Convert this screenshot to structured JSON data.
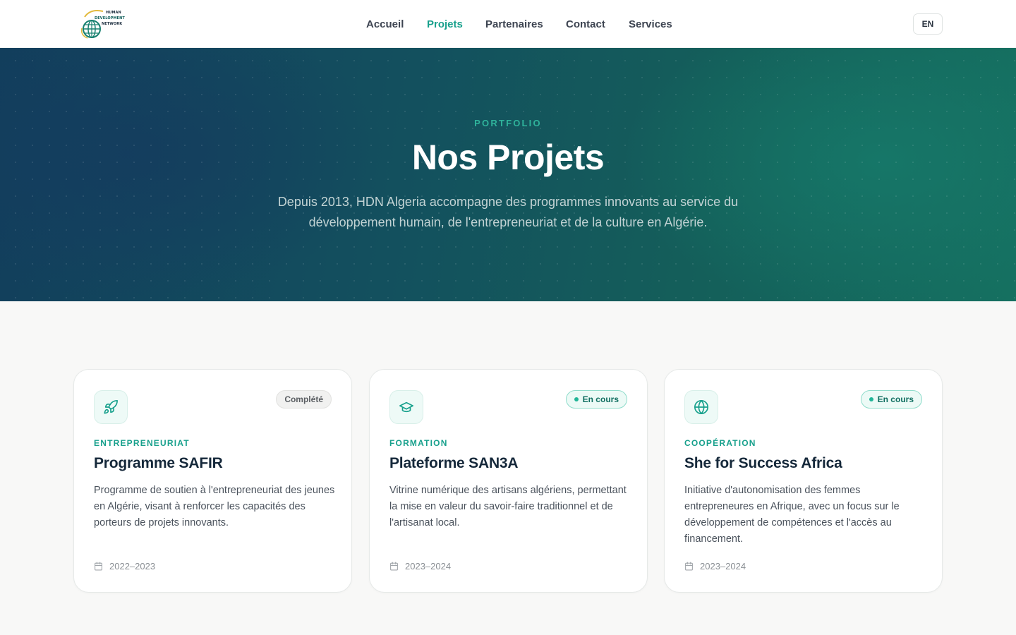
{
  "header": {
    "logo_lines": [
      "HUMAN",
      "DEVELOPMENT",
      "NETWORK"
    ],
    "nav": [
      {
        "label": "Accueil"
      },
      {
        "label": "Projets"
      },
      {
        "label": "Partenaires"
      },
      {
        "label": "Contact"
      },
      {
        "label": "Services"
      }
    ],
    "active_nav": "Projets",
    "lang_label": "EN"
  },
  "hero": {
    "eyebrow": "PORTFOLIO",
    "title": "Nos Projets",
    "description": "Depuis 2013, HDN Algeria accompagne des programmes innovants au service du développement humain, de l'entrepreneuriat et de la culture en Algérie."
  },
  "colors": {
    "accent": "#17a08c",
    "hero_dark": "#123e5c",
    "hero_teal": "#157060",
    "title_dark": "#15283a"
  },
  "projects": [
    {
      "icon": "rocket-icon",
      "status": "Complété",
      "category": "ENTREPRENEURIAT",
      "title": "Programme SAFIR",
      "description": "Programme de soutien à l'entrepreneuriat des jeunes en Algérie, visant à renforcer les capacités des porteurs de projets innovants.",
      "period": "2022–2023"
    },
    {
      "icon": "graduation-cap-icon",
      "status": "En cours",
      "category": "FORMATION",
      "title": "Plateforme SAN3A",
      "description": "Vitrine numérique des artisans algériens, permettant la mise en valeur du savoir-faire traditionnel et de l'artisanat local.",
      "period": "2023–2024"
    },
    {
      "icon": "globe-icon",
      "status": "En cours",
      "category": "COOPÉRATION",
      "title": "She for Success Africa",
      "description": "Initiative d'autonomisation des femmes entrepreneures en Afrique, avec un focus sur le développement de compétences et l'accès au financement.",
      "period": "2023–2024"
    }
  ]
}
